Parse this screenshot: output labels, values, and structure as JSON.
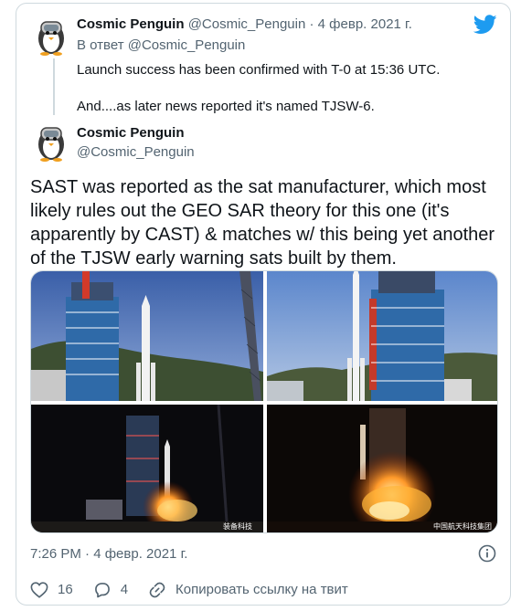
{
  "parent_tweet": {
    "author_name": "Cosmic Penguin",
    "author_handle": "@Cosmic_Penguin",
    "separator": "·",
    "date": "4 февр. 2021 г.",
    "reply_to": "В ответ @Cosmic_Penguin",
    "lines": [
      "Launch success has been confirmed with T-0 at 15:36 UTC.",
      "And....as later news reported it's named TJSW-6."
    ]
  },
  "main_tweet": {
    "author_name": "Cosmic Penguin",
    "author_handle": "@Cosmic_Penguin",
    "text": "SAST was reported as the sat manufacturer, which most likely rules out the GEO SAR theory for this one (it's apparently by CAST) & matches w/ this being yet another of the TJSW early warning sats built by them.",
    "media": {
      "watermark_left": "装备科技",
      "watermark_right": "中国航天科技集团"
    },
    "timestamp": "7:26 PM · 4 февр. 2021 г.",
    "likes": "16",
    "replies": "4",
    "copy_link_label": "Копировать ссылку на твит"
  },
  "colors": {
    "brand": "#1d9bf0",
    "text": "#0f1419",
    "muted": "#536471",
    "border": "#cfd9de"
  },
  "icons": [
    "twitter-bird-icon",
    "info-icon",
    "heart-icon",
    "reply-icon",
    "link-icon"
  ]
}
